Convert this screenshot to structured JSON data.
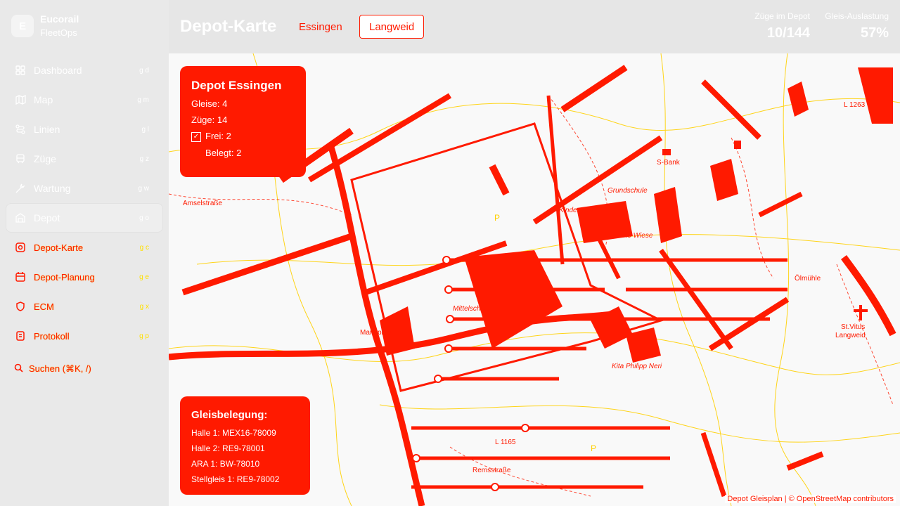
{
  "brand": {
    "logo_letter": "E",
    "name": "Eucorail",
    "sub": "FleetOps"
  },
  "nav": [
    {
      "label": "Dashboard",
      "shortcut": "g d",
      "icon": "grid-icon"
    },
    {
      "label": "Map",
      "shortcut": "g m",
      "icon": "map-icon"
    },
    {
      "label": "Linien",
      "shortcut": "g l",
      "icon": "route-icon"
    },
    {
      "label": "Züge",
      "shortcut": "g z",
      "icon": "train-icon"
    },
    {
      "label": "Wartung",
      "shortcut": "g w",
      "icon": "wrench-icon"
    },
    {
      "label": "Depot",
      "shortcut": "g o",
      "icon": "depot-icon"
    }
  ],
  "subnav": [
    {
      "label": "Depot-Karte",
      "shortcut": "g c",
      "icon": "map-pin-icon"
    },
    {
      "label": "Depot-Planung",
      "shortcut": "g e",
      "icon": "calendar-icon"
    },
    {
      "label": "ECM",
      "shortcut": "g x",
      "icon": "shield-icon"
    },
    {
      "label": "Protokoll",
      "shortcut": "g p",
      "icon": "log-icon"
    }
  ],
  "search": {
    "label": "Suchen (⌘K, /)"
  },
  "header": {
    "title": "Depot-Karte",
    "tabs": [
      "Essingen",
      "Langweid"
    ],
    "selected_tab": "Langweid"
  },
  "stats": [
    {
      "label": "Züge im Depot",
      "value": "10/144"
    },
    {
      "label": "Gleis-Auslastung",
      "value": "57%"
    }
  ],
  "depot_panel": {
    "title": "Depot Essingen",
    "gleise": "Gleise: 4",
    "zuege": "Züge: 14",
    "frei": "Frei: 2",
    "belegt": "Belegt: 2"
  },
  "gleis_panel": {
    "title": "Gleisbelegung:",
    "rows": [
      "Halle 1: MEX16-78009",
      "Halle 2: RE9-78001",
      "ARA 1: BW-78010",
      "Stellgleis 1: RE9-78002"
    ]
  },
  "map_labels": {
    "mittelschule": "Mittelschule",
    "grundschule": "Grundschule",
    "kindergarten": "Kindergarten",
    "hohe_wiese": "Höhe Wiese",
    "kita": "Kita Philipp Neri",
    "st_vitus": "St.Vitus",
    "langweid": "Langweid",
    "oelmuehle": "Ölmühle",
    "bank": "S-Bank",
    "road_l1165": "L 1165",
    "road_l1263": "L 1263",
    "remsstrasse": "Remsstraße",
    "amselstrasse": "Amselstraße",
    "marktplatz": "Marktplatz"
  },
  "attribution": "Depot Gleisplan | © OpenStreetMap contributors",
  "colors": {
    "accent": "#ff1a00",
    "highlight": "#ffd000"
  }
}
